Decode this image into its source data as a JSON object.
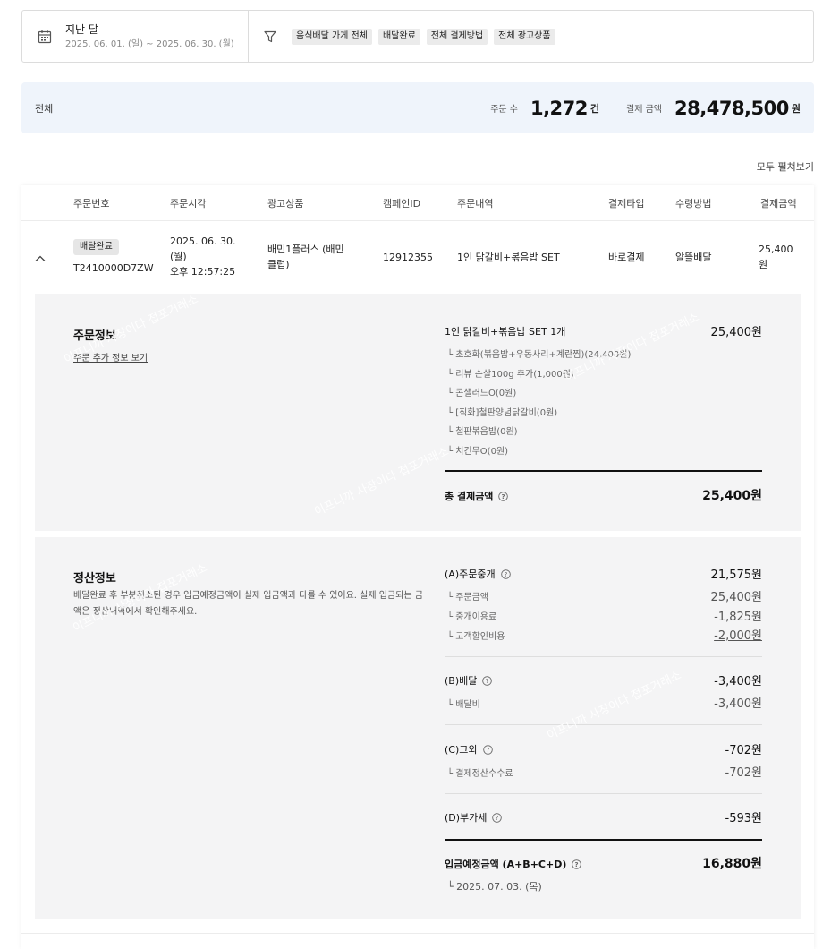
{
  "filter": {
    "period_label": "지난 달",
    "period_range": "2025. 06. 01. (일) ~ 2025. 06. 30. (월)",
    "chips": [
      "음식배달 가게 전체",
      "배달완료",
      "전체 결제방법",
      "전체 광고상품"
    ]
  },
  "summary": {
    "label": "전체",
    "order_count_label": "주문 수",
    "order_count": "1,272",
    "order_count_unit": "건",
    "payment_label": "결제 금액",
    "payment_amount": "28,478,500",
    "payment_unit": "원"
  },
  "expand_all_label": "모두 펼쳐보기",
  "table": {
    "headers": [
      "주문번호",
      "주문시각",
      "광고상품",
      "캠페인ID",
      "주문내역",
      "결제타입",
      "수령방법",
      "결제금액"
    ],
    "row": {
      "status_badge": "배달완료",
      "order_no": "T2410000D7ZW",
      "order_time_line1": "2025. 06. 30.",
      "order_time_line2": "(월)",
      "order_time_line3": "오후 12:57:25",
      "ad_product_line1": "배민1플러스 (배민",
      "ad_product_line2": "클럽)",
      "campaign_id": "12912355",
      "order_detail": "1인 닭갈비+볶음밥 SET",
      "payment_type": "바로결제",
      "delivery_method": "알뜰배달",
      "amount_line1": "25,400",
      "amount_line2": "원"
    }
  },
  "order_info": {
    "title": "주문정보",
    "more_link": "주문 추가 정보 보기",
    "item_name": "1인 닭갈비+볶음밥 SET 1개",
    "item_price": "25,400원",
    "options": [
      "└ 초호화(볶음밥+우동사리+계란찜)(24,400원)",
      "└ 리뷰 순살100g 추가(1,000원)",
      "└ 콘샐러드O(0원)",
      "└ [직화]철판양념닭갈비(0원)",
      "└ 철판볶음밥(0원)",
      "└ 치킨무O(0원)"
    ],
    "total_label": "총 결제금액",
    "total_amount": "25,400원"
  },
  "settlement": {
    "title": "정산정보",
    "note": "배달완료 후 부분취소된 경우 입금예정금액이 실제 입금액과 다를 수 있어요. 실제 입금되는 금액은 정산내역에서 확인해주세요.",
    "a_label": "(A)주문중개",
    "a_amount": "21,575원",
    "a_items": [
      {
        "label": "└ 주문금액",
        "amount": "25,400원"
      },
      {
        "label": "└ 중개이용료",
        "amount": "-1,825원"
      },
      {
        "label": "└ 고객할인비용",
        "amount": "-2,000원"
      }
    ],
    "b_label": "(B)배달",
    "b_amount": "-3,400원",
    "b_items": [
      {
        "label": "└ 배달비",
        "amount": "-3,400원"
      }
    ],
    "c_label": "(C)그외",
    "c_amount": "-702원",
    "c_items": [
      {
        "label": "└ 결제정산수수료",
        "amount": "-702원"
      }
    ],
    "d_label": "(D)부가세",
    "d_amount": "-593원",
    "expected_label": "입금예정금액 (A+B+C+D)",
    "expected_amount": "16,880원",
    "expected_date": "└ 2025. 07. 03. (목)"
  },
  "watermark_text": "이프니까 사장이다 접포거래소",
  "colors": {
    "summary_bg": "#eff4fb",
    "panel_bg": "#f4f4f5",
    "chip_bg": "#ebebeb"
  }
}
